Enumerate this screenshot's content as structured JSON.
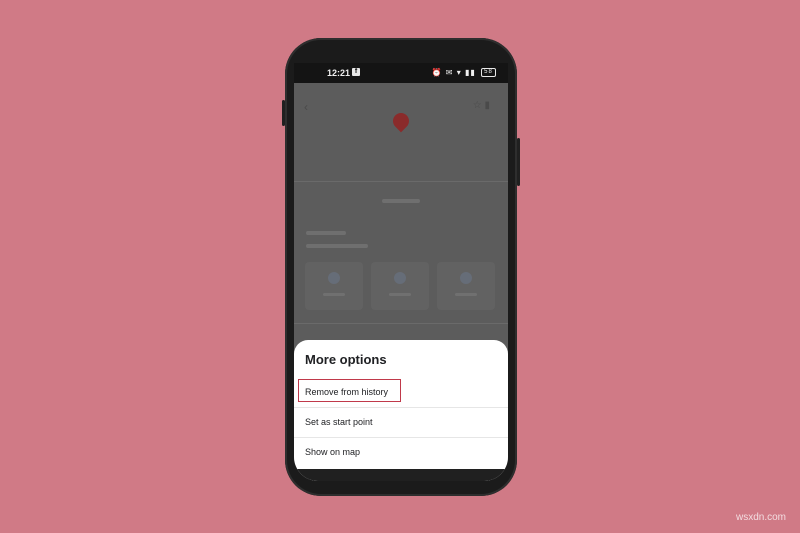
{
  "status_bar": {
    "time": "12:21",
    "app_badge": "f",
    "icons": "⏰ ✉ ▾ ▮▮",
    "battery": "58"
  },
  "sheet": {
    "title": "More options",
    "options": [
      {
        "label": "Remove from history",
        "highlighted": true
      },
      {
        "label": "Set as start point",
        "highlighted": false
      },
      {
        "label": "Show on map",
        "highlighted": false
      }
    ]
  },
  "icons": {
    "back": "‹",
    "save": "☆ ▮"
  },
  "watermark": "wsxdn.com",
  "colors": {
    "background": "#d07a86",
    "highlight": "#c0394a",
    "sheet": "#ffffff"
  }
}
